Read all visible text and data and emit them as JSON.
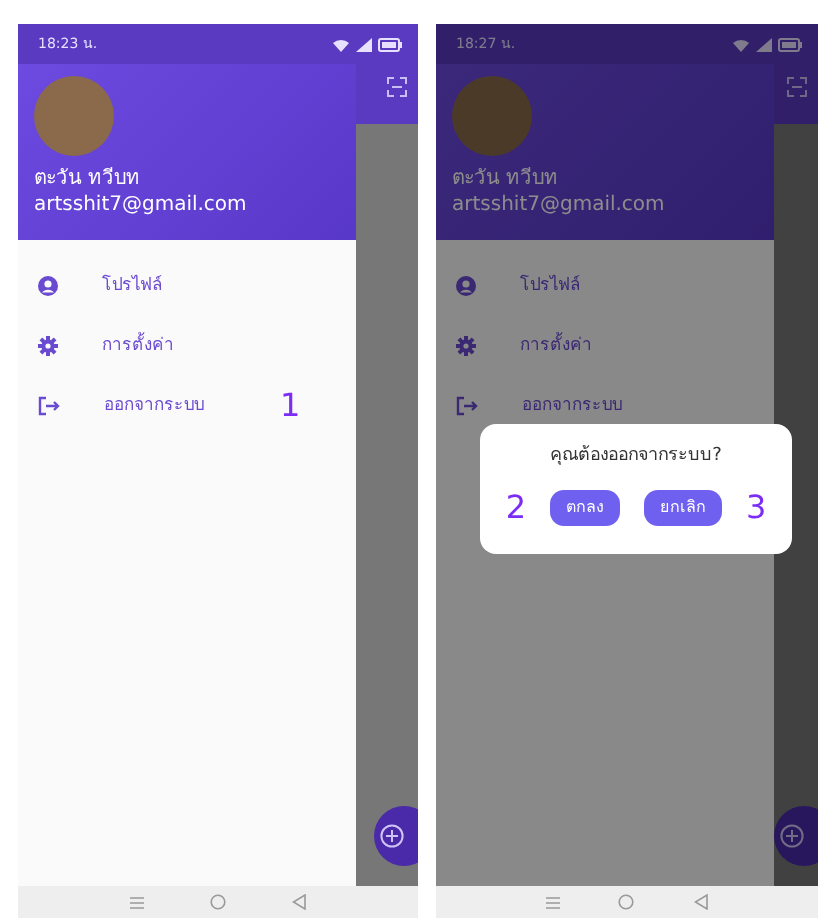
{
  "screens": [
    {
      "status_time": "18:23 น.",
      "dimmed": false,
      "profile": {
        "name": "ตะวัน ทวีบท",
        "email": "artsshit7@gmail.com"
      },
      "menu": [
        {
          "label": "โปรไฟล์",
          "kind": "profile"
        },
        {
          "label": "การตั้งค่า",
          "kind": "settings"
        },
        {
          "label": "ออกจากระบบ",
          "kind": "logout",
          "step": "1"
        }
      ]
    },
    {
      "status_time": "18:27 น.",
      "dimmed": true,
      "profile": {
        "name": "ตะวัน ทวีบท",
        "email": "artsshit7@gmail.com"
      },
      "menu": [
        {
          "label": "โปรไฟล์",
          "kind": "profile"
        },
        {
          "label": "การตั้งค่า",
          "kind": "settings"
        },
        {
          "label": "ออกจากระบบ",
          "kind": "logout"
        }
      ],
      "dialog": {
        "message": "คุณต้องออกจากระบบ?",
        "buttons": [
          {
            "label": "ตกลง",
            "step": "2"
          },
          {
            "label": "ยกเลิก",
            "step": "3"
          }
        ]
      }
    }
  ]
}
